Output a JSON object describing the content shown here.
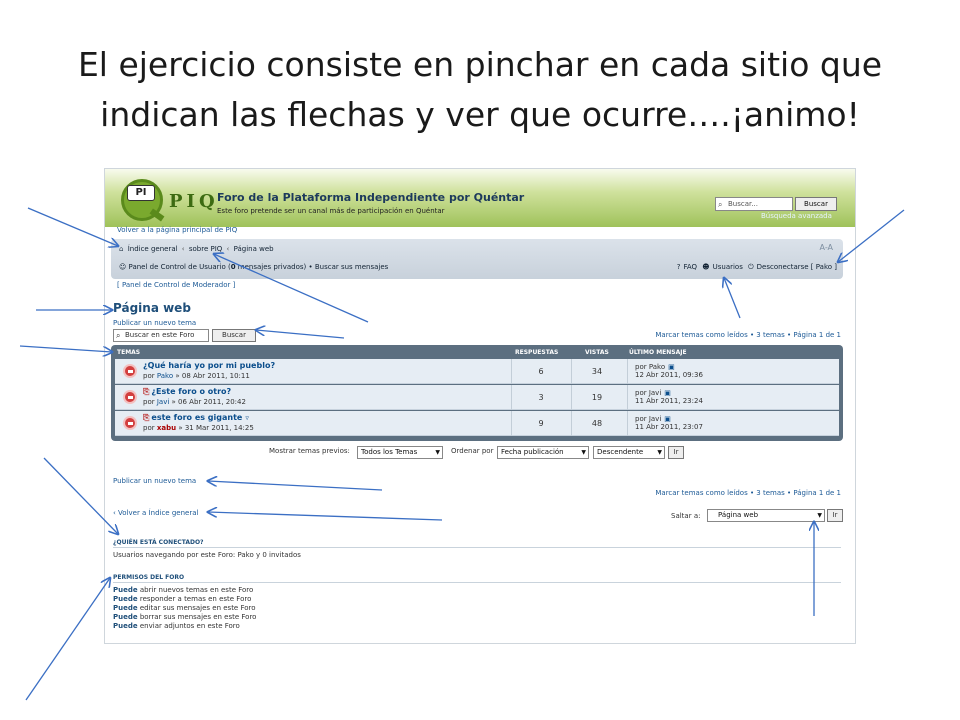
{
  "slide": {
    "title_line1": "El ejercicio consiste en pinchar en cada sitio que",
    "title_line2": "indican las flechas y ver que ocurre….¡animo!"
  },
  "forum": {
    "logo_pi": "PI",
    "logo_text": "PIQ",
    "site_title": "Foro de la Plataforma Independiente por Quéntar",
    "site_desc": "Este foro pretende ser un canal más de participación en Quéntar",
    "search_placeholder": "Buscar...",
    "search_button": "Buscar",
    "advanced_search": "Búsqueda avanzada",
    "back_to_site": "Volver a la página principal de PIQ",
    "breadcrumbs": [
      "Índice general",
      "sobre PIQ",
      "Página web"
    ],
    "breadcrumb_sep": "‹",
    "font_size_icon": "A-A",
    "ucp_prefix": "Panel de Control de Usuario (",
    "ucp_count": "0",
    "ucp_suffix": " mensajes privados)",
    "nav_sep": "•",
    "search_posts": "Buscar sus mensajes",
    "faq": "FAQ",
    "members": "Usuarios",
    "logout": "Desconectarse [ Pako ]",
    "mod_panel": "[ Panel de Control de Moderador ]",
    "page_heading": "Página web",
    "new_topic": "Publicar un nuevo tema",
    "forum_search_placeholder": "Buscar en este Foro",
    "forum_search_button": "Buscar",
    "pagination": "Marcar temas como leídos • 3 temas • Página 1 de 1",
    "table_headers": {
      "topics": "TEMAS",
      "replies": "RESPUESTAS",
      "views": "VISTAS",
      "last_post": "ÚLTIMO MENSAJE"
    },
    "topics": [
      {
        "title": "¿Qué haría yo por mi pueblo?",
        "meta_prefix": "por",
        "author": "Pako",
        "date": "» 08 Abr 2011, 10:11",
        "replies": "6",
        "views": "34",
        "last_by": "por Pako",
        "last_date": "12 Abr 2011, 09:36"
      },
      {
        "title": "¿Este foro o otro?",
        "meta_prefix": "por",
        "author": "Javi",
        "date": "» 06 Abr 2011, 20:42",
        "replies": "3",
        "views": "19",
        "last_by": "por Javi",
        "last_date": "11 Abr 2011, 23:24"
      },
      {
        "title": "este foro es gigante",
        "meta_prefix": "por",
        "author": "xabu",
        "date": "» 31 Mar 2011, 14:25",
        "replies": "9",
        "views": "48",
        "last_by": "por Javi",
        "last_date": "11 Abr 2011, 23:07"
      }
    ],
    "show_topics_label": "Mostrar temas previos:",
    "show_topics_value": "Todos los Temas",
    "order_by_label": "Ordenar por",
    "order_by_value": "Fecha publicación",
    "direction_value": "Descendente",
    "go_button": "Ir",
    "return_link": "Volver a Índice general",
    "jump_to_label": "Saltar a:",
    "jump_to_value": "Página web",
    "who_online_title": "¿QUIÉN ESTÁ CONECTADO?",
    "who_online_text": "Usuarios navegando por este Foro: Pako y 0 invitados",
    "permissions_title": "PERMISOS DEL FORO",
    "permissions_word": "Puede",
    "permissions": [
      "abrir nuevos temas en este Foro",
      "responder a temas en este Foro",
      "editar sus mensajes en este Foro",
      "borrar sus mensajes en este Foro",
      "enviar adjuntos en este Foro"
    ]
  },
  "colors": {
    "arrow": "#3b6fc4",
    "link": "#1d5a96",
    "table_header": "#5c6f80"
  }
}
